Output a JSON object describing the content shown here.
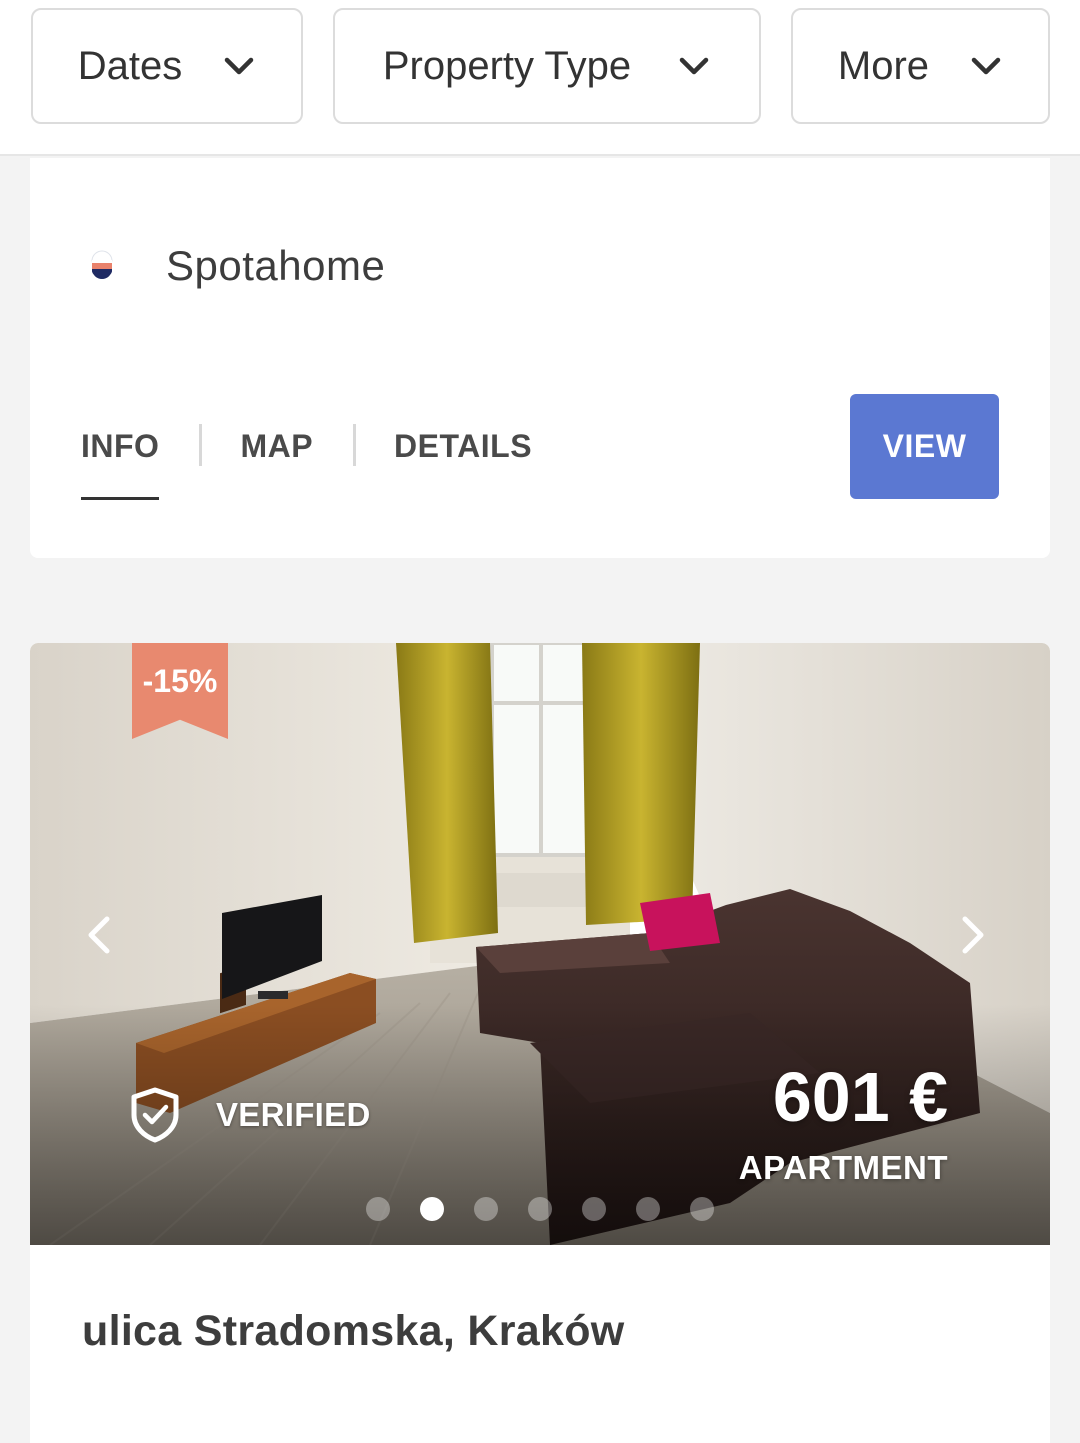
{
  "filters": {
    "dates": "Dates",
    "property_type": "Property Type",
    "more": "More"
  },
  "listing_1": {
    "provider_name": "Spotahome",
    "tabs": [
      {
        "label": "INFO",
        "active": true
      },
      {
        "label": "MAP",
        "active": false
      },
      {
        "label": "DETAILS",
        "active": false
      }
    ],
    "view_label": "VIEW"
  },
  "listing_2": {
    "discount": "-15%",
    "verified_label": "VERIFIED",
    "price": "601 €",
    "property_type": "APARTMENT",
    "photo_count": 7,
    "active_photo_index": 1,
    "address": "ulica Stradomska, Kraków"
  },
  "icons": {
    "filter_chevron": "chevron-down-icon",
    "prev": "chevron-left-icon",
    "next": "chevron-right-icon",
    "verified": "shield-check-icon"
  },
  "colors": {
    "view_button": "#5b78d2",
    "discount_badge": "#e8896f",
    "background": "#f3f3f3"
  }
}
